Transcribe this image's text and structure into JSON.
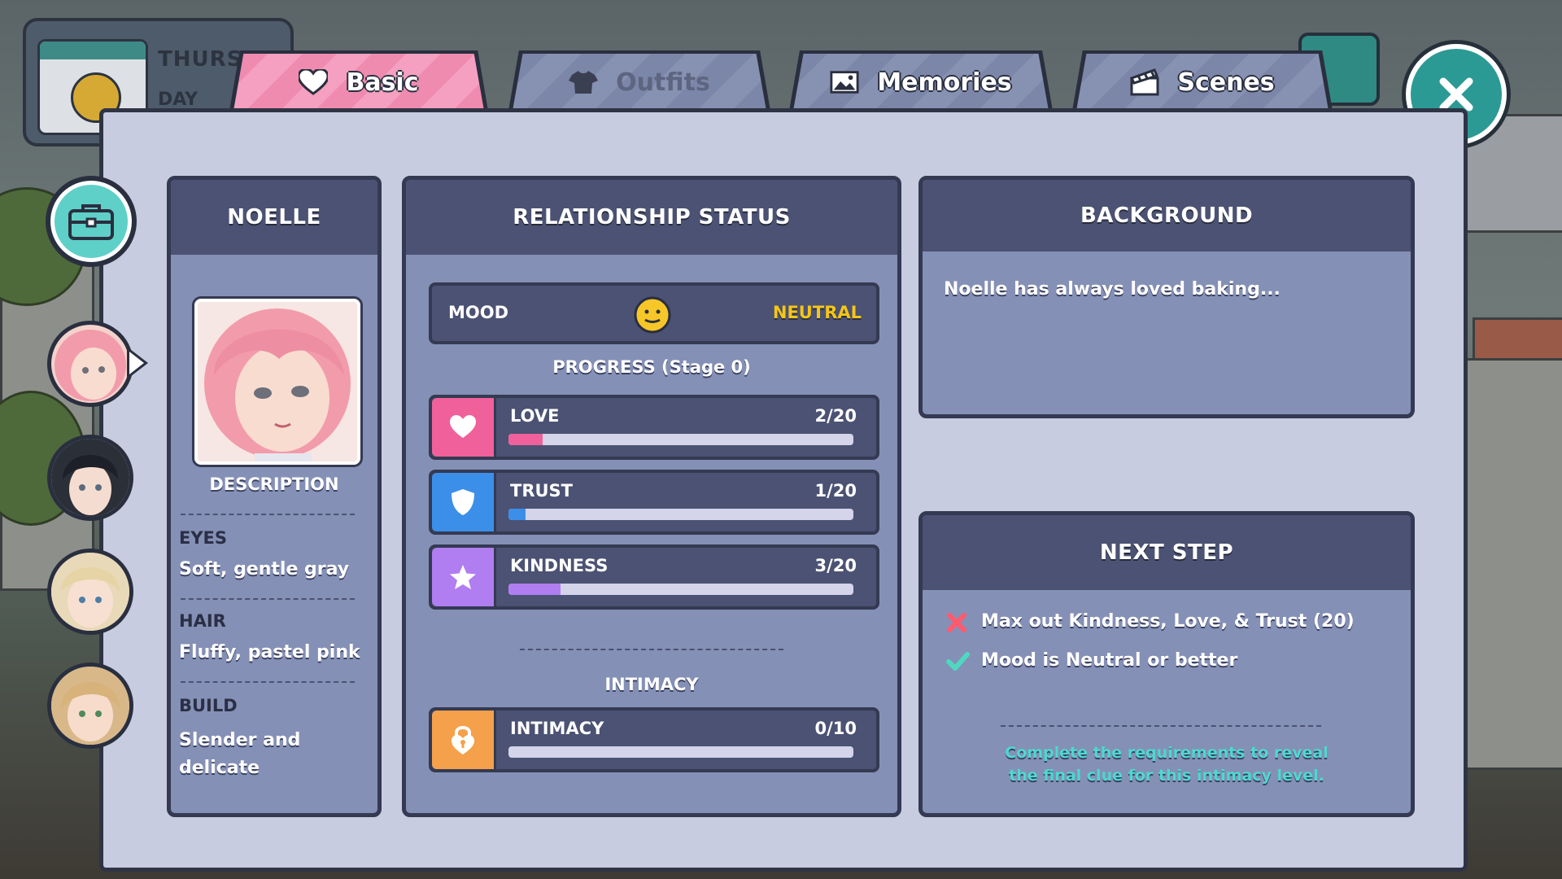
{
  "calendar": {
    "day_name": "THURSD",
    "day_part": "DAY"
  },
  "tabs": [
    {
      "label": "Basic",
      "icon": "heart-icon",
      "active": true
    },
    {
      "label": "Outfits",
      "icon": "shirt-icon",
      "active": false
    },
    {
      "label": "Memories",
      "icon": "image-icon",
      "active": false
    },
    {
      "label": "Scenes",
      "icon": "clapperboard-icon",
      "active": false
    }
  ],
  "profile": {
    "name": "NOELLE",
    "description_label": "DESCRIPTION",
    "eyes_label": "EYES",
    "eyes_value": "Soft, gentle gray",
    "hair_label": "HAIR",
    "hair_value": "Fluffy, pastel pink",
    "build_label": "BUILD",
    "build_value": "Slender and delicate"
  },
  "relationship": {
    "title": "RELATIONSHIP STATUS",
    "mood_label": "MOOD",
    "mood_value": "NEUTRAL",
    "progress_label": "PROGRESS (Stage 0)",
    "stats": [
      {
        "name": "LOVE",
        "value": "2/20",
        "fraction": 0.1,
        "color": "#f0609a",
        "icon": "heart-icon"
      },
      {
        "name": "TRUST",
        "value": "1/20",
        "fraction": 0.05,
        "color": "#3b8fe8",
        "icon": "shield-icon"
      },
      {
        "name": "KINDNESS",
        "value": "3/20",
        "fraction": 0.15,
        "color": "#b07ef0",
        "icon": "star-icon"
      }
    ],
    "intimacy_title": "INTIMACY",
    "intimacy": {
      "name": "INTIMACY",
      "value": "0/10",
      "fraction": 0,
      "color": "#f5a04a",
      "icon": "lock-icon"
    }
  },
  "background": {
    "title": "BACKGROUND",
    "text": "Noelle has always loved baking..."
  },
  "next_step": {
    "title": "NEXT STEP",
    "requirements": [
      {
        "text": "Max out Kindness, Love, & Trust (20)",
        "met": false
      },
      {
        "text": "Mood is Neutral or better",
        "met": true
      }
    ],
    "hint": "Complete the requirements to reveal the final clue for this intimacy level."
  },
  "colors": {
    "accent_teal": "#2c9a94",
    "tab_active": "#f08bb0",
    "mood_value": "#f5c518",
    "hint_text": "#4fd8d0"
  }
}
